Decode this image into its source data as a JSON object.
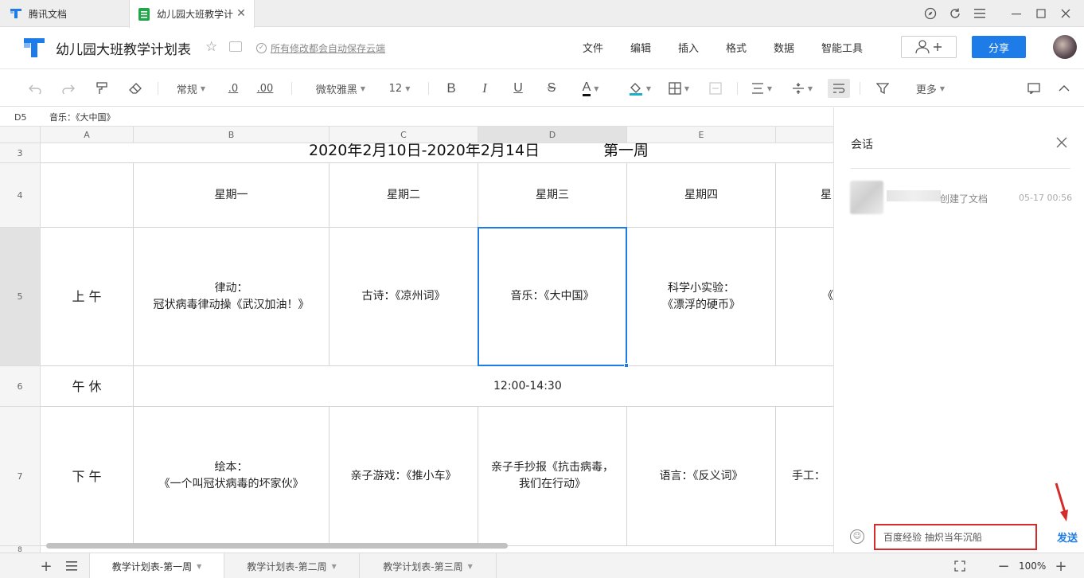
{
  "window": {
    "tabs": [
      {
        "label": "腾讯文档"
      },
      {
        "label": "幼儿园大班教学计"
      }
    ],
    "controls": [
      "compass-icon",
      "refresh-icon",
      "menu-icon",
      "minimize-icon",
      "maximize-icon",
      "close-icon"
    ]
  },
  "doc": {
    "title": "幼儿园大班教学计划表",
    "save_status": "所有修改都会自动保存云端",
    "menu": [
      "文件",
      "编辑",
      "插入",
      "格式",
      "数据",
      "智能工具"
    ],
    "share_label": "分享"
  },
  "toolbar": {
    "number_format": "常规",
    "decimal_dec": ".0",
    "decimal_inc": ".00",
    "font_family": "微软雅黑",
    "font_size": "12",
    "bold": "B",
    "italic": "I",
    "underline": "U",
    "strike": "S",
    "font_color": "A",
    "more": "更多",
    "accent_color": "#1e7ce8"
  },
  "formula": {
    "cell_ref": "D5",
    "value": "音乐：《大中国》"
  },
  "sheet": {
    "columns": [
      "A",
      "B",
      "C",
      "D",
      "E"
    ],
    "selected_column": "D",
    "rows": [
      "3",
      "4",
      "5",
      "6",
      "7",
      "8"
    ],
    "selected_row": "5",
    "title_date": "2020年2月10日-2020年2月14日",
    "title_week": "第一周",
    "header": [
      "星期一",
      "星期二",
      "星期三",
      "星期四",
      "星"
    ],
    "morning": {
      "label": "上 午",
      "cells": [
        "律动：\n冠状病毒律动操《武汉加油！》",
        "古诗：《凉州词》",
        "音乐：《大中国》",
        "科学小实验：\n《漂浮的硬币》",
        "《"
      ]
    },
    "noon": {
      "label": "午 休",
      "value": "12:00-14:30"
    },
    "afternoon": {
      "label": "下 午",
      "cells": [
        "绘本：\n《一个叫冠状病毒的坏家伙》",
        "亲子游戏：《推小车》",
        "亲子手抄报《抗击病毒，\n我们在行动》",
        "语言：《反义词》",
        "手工："
      ]
    }
  },
  "sheet_tabs": [
    "教学计划表-第一周",
    "教学计划表-第二周",
    "教学计划表-第三周"
  ],
  "zoom": "100%",
  "panel": {
    "title": "会话",
    "activity_text": "创建了文档",
    "activity_time": "05-17 00:56",
    "input_value": "百度经验 抽炽当年沉船",
    "send_label": "发送"
  }
}
